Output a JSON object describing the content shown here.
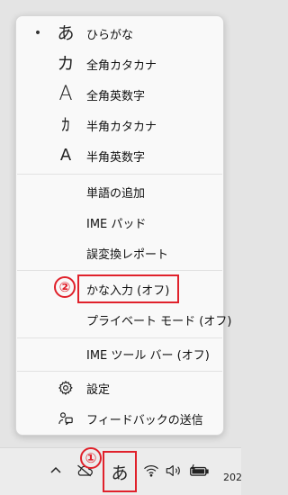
{
  "menu": {
    "items": [
      {
        "label": "ひらがな",
        "icon": "あ",
        "icon_name": "hiragana-icon",
        "selected": true
      },
      {
        "label": "全角カタカナ",
        "icon": "カ",
        "icon_name": "fullwidth-katakana-icon"
      },
      {
        "label": "全角英数字",
        "icon": "A",
        "icon_name": "fullwidth-alphanumeric-icon"
      },
      {
        "label": "半角カタカナ",
        "icon": "ｶ",
        "icon_name": "halfwidth-katakana-icon"
      },
      {
        "label": "半角英数字",
        "icon": "A",
        "icon_name": "halfwidth-alphanumeric-icon"
      },
      {
        "label": "単語の追加"
      },
      {
        "label": "IME パッド"
      },
      {
        "label": "誤変換レポート"
      },
      {
        "label": "かな入力 (オフ)"
      },
      {
        "label": "プライベート モード (オフ)"
      },
      {
        "label": "IME ツール バー (オフ)"
      },
      {
        "label": "設定",
        "icon_name": "gear-icon"
      },
      {
        "label": "フィードバックの送信",
        "icon_name": "feedback-icon"
      }
    ],
    "bullet": "•"
  },
  "annotations": {
    "step1": "①",
    "step2": "②",
    "color": "#e0212b"
  },
  "taskbar": {
    "ime_indicator": "あ",
    "clock_partial": "202",
    "chevron": "^"
  }
}
